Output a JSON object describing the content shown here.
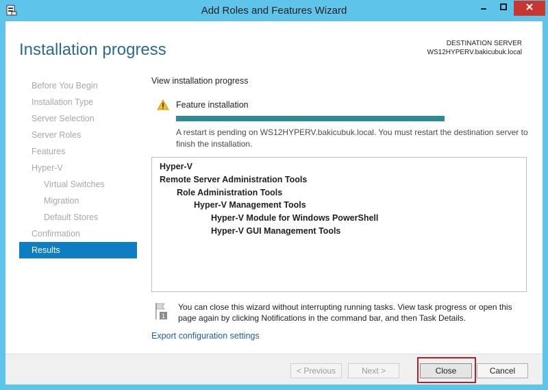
{
  "window": {
    "title": "Add Roles and Features Wizard",
    "titlebar_color": "#5ec4ea",
    "controls": [
      "minimize-icon",
      "maximize-icon",
      "close-icon"
    ]
  },
  "header": {
    "title": "Installation progress",
    "destination_label": "DESTINATION SERVER",
    "destination_server": "WS12HYPERV.bakicubuk.local"
  },
  "sidebar": {
    "items": [
      {
        "label": "Before You Begin",
        "level": 0,
        "active": false
      },
      {
        "label": "Installation Type",
        "level": 0,
        "active": false
      },
      {
        "label": "Server Selection",
        "level": 0,
        "active": false
      },
      {
        "label": "Server Roles",
        "level": 0,
        "active": false
      },
      {
        "label": "Features",
        "level": 0,
        "active": false
      },
      {
        "label": "Hyper-V",
        "level": 0,
        "active": false
      },
      {
        "label": "Virtual Switches",
        "level": 1,
        "active": false
      },
      {
        "label": "Migration",
        "level": 1,
        "active": false
      },
      {
        "label": "Default Stores",
        "level": 1,
        "active": false
      },
      {
        "label": "Confirmation",
        "level": 0,
        "active": false
      },
      {
        "label": "Results",
        "level": 0,
        "active": true
      }
    ],
    "active_color": "#0f7dc2"
  },
  "main": {
    "section_label": "View installation progress",
    "feature_label": "Feature installation",
    "progress": 1.0,
    "progress_color": "#2b8a96",
    "restart_message": "A restart is pending on WS12HYPERV.bakicubuk.local. You must restart the destination server to finish the installation.",
    "results": [
      {
        "label": "Hyper-V",
        "level": 0
      },
      {
        "label": "Remote Server Administration Tools",
        "level": 0
      },
      {
        "label": "Role Administration Tools",
        "level": 1
      },
      {
        "label": "Hyper-V Management Tools",
        "level": 2
      },
      {
        "label": "Hyper-V Module for Windows PowerShell",
        "level": 3
      },
      {
        "label": "Hyper-V GUI Management Tools",
        "level": 3
      }
    ],
    "notice": "You can close this wizard without interrupting running tasks. View task progress or open this page again by clicking Notifications in the command bar, and then Task Details.",
    "notice_badge": "1",
    "export_link": "Export configuration settings"
  },
  "footer": {
    "previous_label": "< Previous",
    "next_label": "Next >",
    "close_label": "Close",
    "cancel_label": "Cancel",
    "highlight_color": "#b0202a"
  }
}
